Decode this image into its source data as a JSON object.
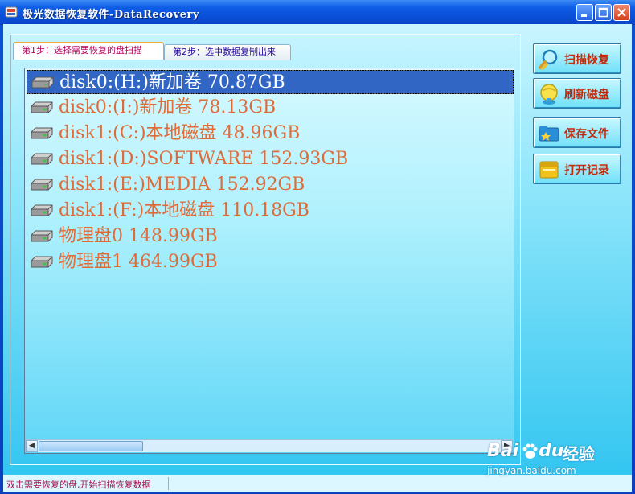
{
  "window": {
    "title": "极光数据恢复软件-DataRecovery"
  },
  "tabs": [
    {
      "label": "第1步：选择需要恢复的盘扫描",
      "active": true
    },
    {
      "label": "第2步：选中数据复制出来",
      "active": false
    }
  ],
  "drives": [
    {
      "label": "disk0:(H:)新加卷 70.87GB",
      "selected": true
    },
    {
      "label": "disk0:(I:)新加卷 78.13GB"
    },
    {
      "label": "disk1:(C:)本地磁盘 48.96GB"
    },
    {
      "label": "disk1:(D:)SOFTWARE 152.93GB"
    },
    {
      "label": "disk1:(E:)MEDIA 152.92GB"
    },
    {
      "label": "disk1:(F:)本地磁盘 110.18GB"
    },
    {
      "label": "物理盘0 148.99GB"
    },
    {
      "label": "物理盘1 464.99GB"
    }
  ],
  "buttons": [
    {
      "label": "扫描恢复",
      "icon": "magnifier-icon"
    },
    {
      "label": "刷新磁盘",
      "icon": "refresh-globe-icon"
    },
    {
      "label": "保存文件",
      "icon": "save-folder-icon"
    },
    {
      "label": "打开记录",
      "icon": "open-folder-icon"
    }
  ],
  "status": {
    "text": "双击需要恢复的盘,开始扫描恢复数据"
  },
  "watermark": {
    "brand": "Bai",
    "brand_tail": "du",
    "cn": "经验",
    "url": "jingyan.baidu.com"
  },
  "colors": {
    "drive_text": "#de6b38",
    "selected_row": "#3166c5",
    "button_text": "#c02d0e",
    "status_text": "#a8154c"
  }
}
